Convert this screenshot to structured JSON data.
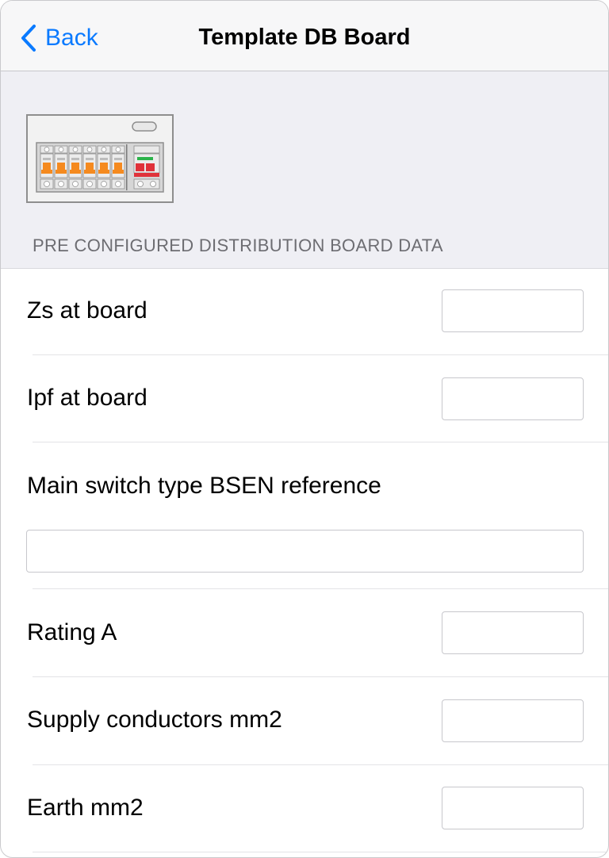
{
  "nav": {
    "back_label": "Back",
    "title": "Template DB Board"
  },
  "header": {
    "image_icon": "distribution-board-icon",
    "section_title": "PRE CONFIGURED DISTRIBUTION BOARD DATA"
  },
  "fields": [
    {
      "label": "Zs at board",
      "value": ""
    },
    {
      "label": "Ipf at board",
      "value": ""
    },
    {
      "label": "Main switch type BSEN reference",
      "value": ""
    },
    {
      "label": "Rating A",
      "value": ""
    },
    {
      "label": "Supply conductors mm2",
      "value": ""
    },
    {
      "label": "Earth mm2",
      "value": ""
    }
  ],
  "colors": {
    "accent": "#0a7aff",
    "nav_background": "#f7f7f8",
    "header_background": "#efeff4",
    "breaker_orange": "#f58a1f",
    "main_switch_red": "#e0323a",
    "indicator_green": "#2bb34a"
  }
}
